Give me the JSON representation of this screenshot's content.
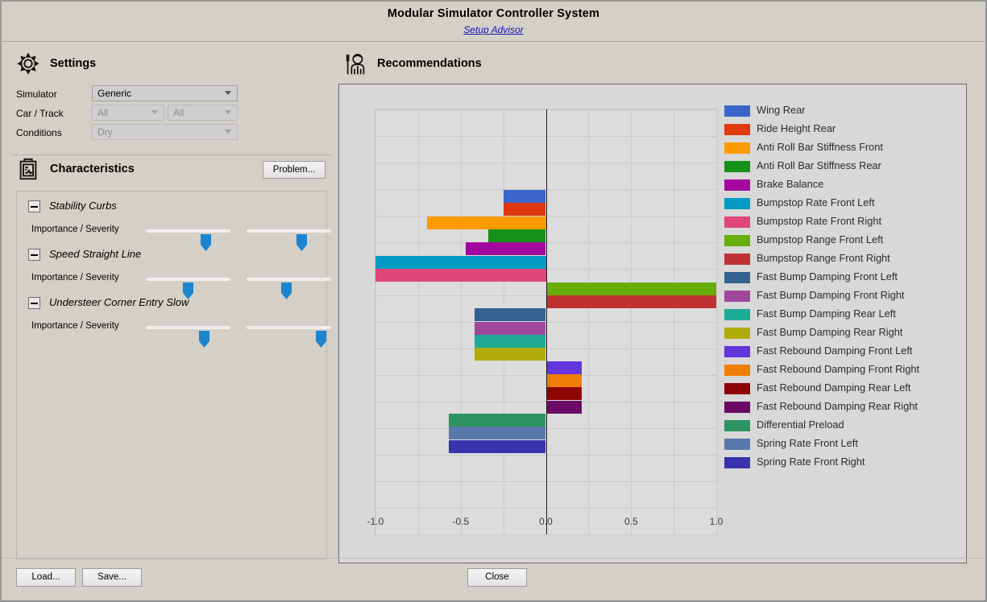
{
  "window": {
    "title": "Modular Simulator Controller System",
    "subtitle_link": "Setup Advisor"
  },
  "settings": {
    "header": "Settings",
    "header_icon": "gear-icon",
    "fields": [
      {
        "label": "Simulator",
        "value": "Generic",
        "enabled": true
      },
      {
        "label": "Car / Track",
        "value": "All",
        "value2": "All",
        "enabled": false
      },
      {
        "label": "Conditions",
        "value": "Dry",
        "enabled": false
      }
    ]
  },
  "characteristics": {
    "header": "Characteristics",
    "header_icon": "clipboard-icon",
    "problem_button": "Problem...",
    "slider_label": "Importance / Severity",
    "items": [
      {
        "title": "Stability Curbs",
        "importance": 0.72,
        "severity": 0.66
      },
      {
        "title": "Speed Straight Line",
        "importance": 0.5,
        "severity": 0.47
      },
      {
        "title": "Understeer Corner Entry Slow",
        "importance": 0.7,
        "severity": 0.88
      }
    ]
  },
  "recommendations": {
    "header": "Recommendations",
    "header_icon": "mechanic-icon"
  },
  "chart_data": {
    "type": "bar",
    "orientation": "horizontal",
    "title": "",
    "xlabel": "",
    "ylabel": "",
    "xlim": [
      -1.0,
      1.0
    ],
    "xticks": [
      "-1.0",
      "-0.5",
      "0.0",
      "0.5",
      "1.0"
    ],
    "xtick_values": [
      -1.0,
      -0.5,
      0.0,
      0.5,
      1.0
    ],
    "grid": true,
    "legend_position": "right",
    "categories": [
      "Wing Rear",
      "Ride Height Rear",
      "Anti Roll Bar Stiffness Front",
      "Anti Roll Bar Stiffness Rear",
      "Brake Balance",
      "Bumpstop Rate Front Left",
      "Bumpstop Rate Front Right",
      "Bumpstop Range Front Left",
      "Bumpstop Range Front Right",
      "Fast Bump Damping Front Left",
      "Fast Bump Damping Front Right",
      "Fast Bump Damping Rear Left",
      "Fast Bump Damping Rear Right",
      "Fast Rebound Damping Front Left",
      "Fast Rebound Damping Front Right",
      "Fast Rebound Damping Rear Left",
      "Fast Rebound Damping Rear Right",
      "Differential Preload",
      "Spring Rate Front Left",
      "Spring Rate Front Right"
    ],
    "values": [
      -0.25,
      -0.25,
      -0.7,
      -0.34,
      -0.47,
      -1.0,
      -1.0,
      1.0,
      1.0,
      -0.42,
      -0.42,
      -0.42,
      -0.42,
      0.21,
      0.21,
      0.21,
      0.21,
      -0.57,
      -0.57,
      -0.57
    ],
    "colors": [
      "#3a66cc",
      "#e0380f",
      "#fd9a02",
      "#159019",
      "#a3079f",
      "#039bc4",
      "#e04678",
      "#67ae0a",
      "#c03132",
      "#336291",
      "#a0479e",
      "#1eab96",
      "#b1ab09",
      "#6434dc",
      "#ef7e05",
      "#8e0403",
      "#6b0a66",
      "#2d9460",
      "#5878ac",
      "#3733ac"
    ]
  },
  "footer": {
    "load_button": "Load...",
    "save_button": "Save...",
    "close_button": "Close"
  }
}
